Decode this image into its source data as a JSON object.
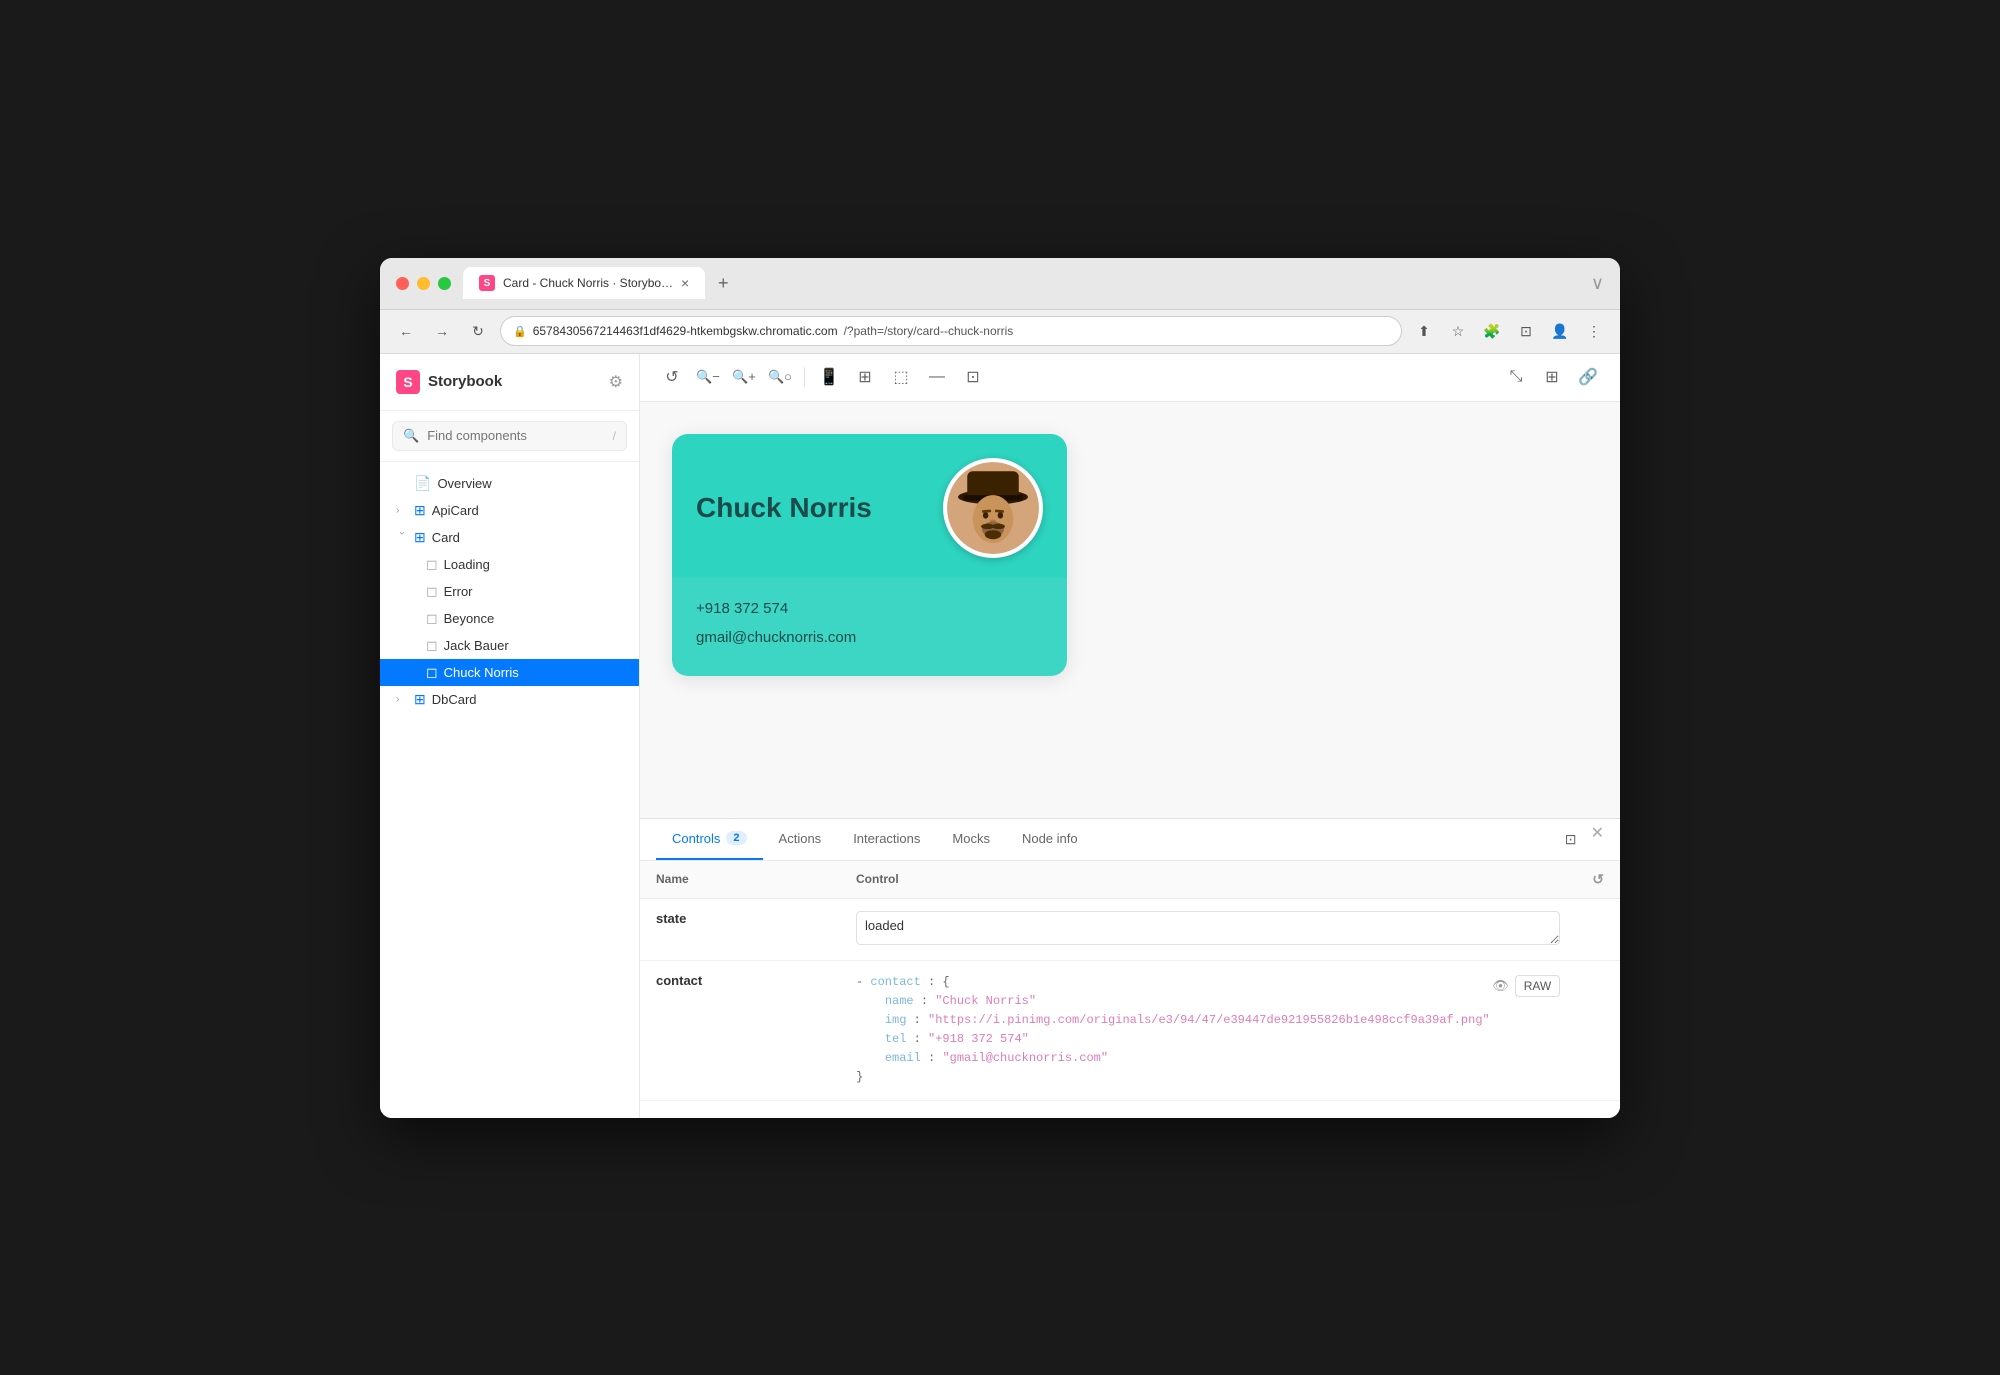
{
  "browser": {
    "tab_label": "Card - Chuck Norris · Storybo…",
    "address": "6578430567214463f1df4629-htkembgskw.chromatic.com",
    "address_path": "/?path=/story/card--chuck-norris",
    "favicon_letter": "S"
  },
  "sidebar": {
    "title": "Storybook",
    "settings_label": "⚙",
    "search_placeholder": "Find components",
    "search_shortcut": "/",
    "tree": [
      {
        "id": "overview",
        "label": "Overview",
        "icon": "📄",
        "type": "leaf",
        "indent": 0,
        "chevron": ""
      },
      {
        "id": "apicard",
        "label": "ApiCard",
        "icon": "⊞",
        "type": "group",
        "indent": 0,
        "chevron": "›"
      },
      {
        "id": "card",
        "label": "Card",
        "icon": "⊞",
        "type": "group-open",
        "indent": 0,
        "chevron": "›"
      },
      {
        "id": "loading",
        "label": "Loading",
        "icon": "◻",
        "type": "story",
        "indent": 1,
        "chevron": ""
      },
      {
        "id": "error",
        "label": "Error",
        "icon": "◻",
        "type": "story",
        "indent": 1,
        "chevron": ""
      },
      {
        "id": "beyonce",
        "label": "Beyonce",
        "icon": "◻",
        "type": "story",
        "indent": 1,
        "chevron": ""
      },
      {
        "id": "jackbauer",
        "label": "Jack Bauer",
        "icon": "◻",
        "type": "story",
        "indent": 1,
        "chevron": ""
      },
      {
        "id": "chucknorris",
        "label": "Chuck Norris",
        "icon": "◻",
        "type": "story-active",
        "indent": 1,
        "chevron": ""
      },
      {
        "id": "dbcard",
        "label": "DbCard",
        "icon": "⊞",
        "type": "group",
        "indent": 0,
        "chevron": "›"
      }
    ]
  },
  "toolbar": {
    "buttons": [
      "↺",
      "🔍−",
      "🔍+",
      "🔍○",
      "|",
      "📱",
      "⊞",
      "⬚",
      "—",
      "⊡",
      "|"
    ],
    "right_buttons": [
      "⤡",
      "⊞",
      "🔗"
    ]
  },
  "card": {
    "name": "Chuck Norris",
    "phone": "+918 372 574",
    "email": "gmail@chucknorris.com",
    "bg_color": "#2dd4bf",
    "body_color": "#3dd6c4"
  },
  "bottom_panel": {
    "tabs": [
      {
        "id": "controls",
        "label": "Controls",
        "badge": "2",
        "active": true
      },
      {
        "id": "actions",
        "label": "Actions",
        "badge": "",
        "active": false
      },
      {
        "id": "interactions",
        "label": "Interactions",
        "badge": "",
        "active": false
      },
      {
        "id": "mocks",
        "label": "Mocks",
        "badge": "",
        "active": false
      },
      {
        "id": "nodeinfo",
        "label": "Node info",
        "badge": "",
        "active": false
      }
    ],
    "controls_headers": {
      "name": "Name",
      "control": "Control"
    },
    "controls_rows": [
      {
        "name": "state",
        "value": "loaded"
      },
      {
        "name": "contact",
        "json": {
          "contact_key": "contact",
          "name_key": "name",
          "name_val": "\"Chuck Norris\"",
          "img_key": "img",
          "img_val": "\"https://i.pinimg.com/originals/e3/94/47/e39447de921955826b1e498ccf9a39af.png\"",
          "tel_key": "tel",
          "tel_val": "\"+918 372 574\"",
          "email_key": "email",
          "email_val": "\"gmail@chucknorris.com\""
        },
        "raw_label": "RAW"
      }
    ]
  }
}
